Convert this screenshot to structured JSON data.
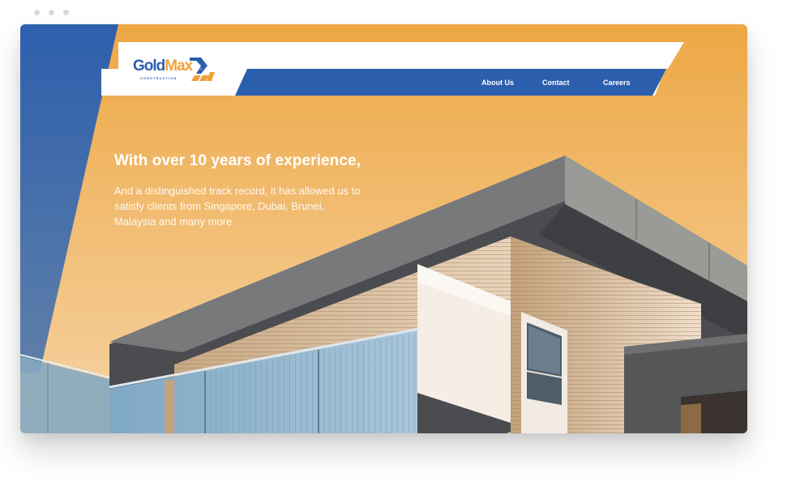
{
  "browser": {
    "dots": [
      "close",
      "minimize",
      "maximize"
    ]
  },
  "brand": {
    "logo_primary": "Gold",
    "logo_secondary": "Max",
    "logo_tagline": "CONSTRUCTION",
    "logo_mark_icon": "double-chevron-logo-mark",
    "colors": {
      "blue": "#2b5fae",
      "orange": "#f0a23a",
      "sky_top": "#eda744",
      "sky_bottom": "#f6d3a4"
    }
  },
  "nav": {
    "items": [
      {
        "label": "About Us"
      },
      {
        "label": "Contact"
      },
      {
        "label": "Careers"
      }
    ]
  },
  "hero": {
    "title": "With over 10 years of experience,",
    "body": "And a distinguished track record, it has allowed us to satisfy clients from Singapore, Dubai, Brunei, Malaysia and many more"
  }
}
